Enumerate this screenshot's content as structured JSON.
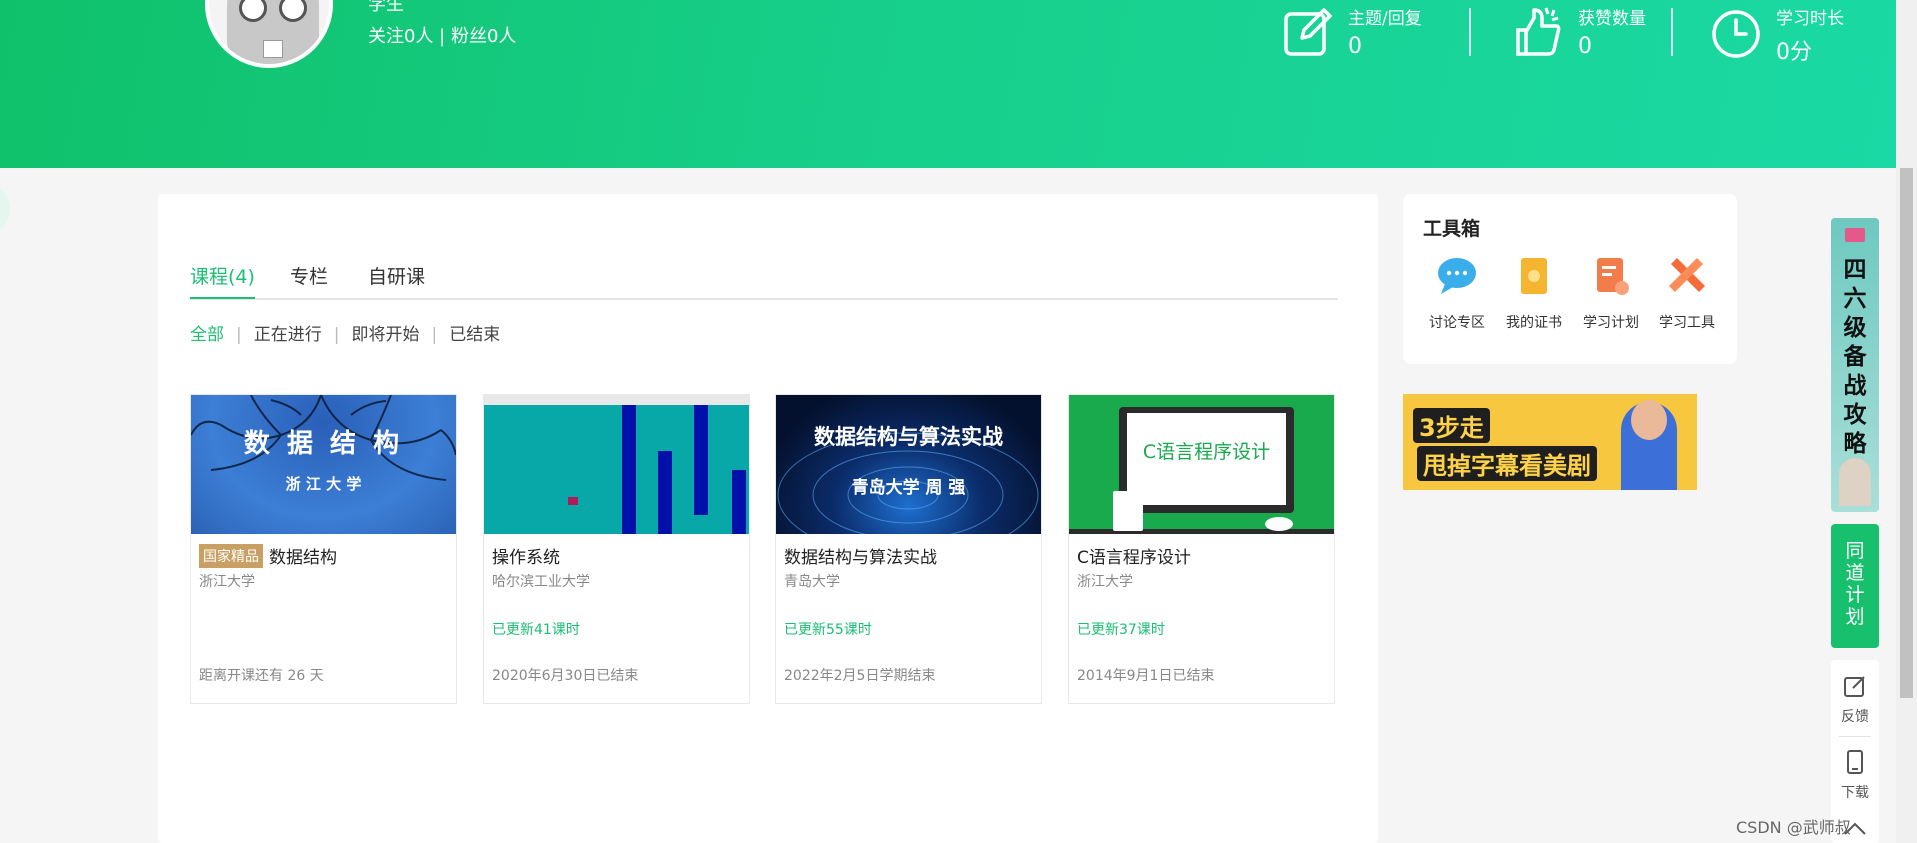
{
  "profile": {
    "name": "学生",
    "follow_text": "关注0人 | 粉丝0人"
  },
  "stats": [
    {
      "label": "主题/回复",
      "value": "0",
      "icon": "edit-icon"
    },
    {
      "label": "获赞数量",
      "value": "0",
      "icon": "thumbs-up-icon"
    },
    {
      "label": "学习时长",
      "value": "0分",
      "icon": "clock-icon"
    }
  ],
  "tabs": [
    {
      "label": "课程(4)",
      "active": true
    },
    {
      "label": "专栏",
      "active": false
    },
    {
      "label": "自研课",
      "active": false
    }
  ],
  "filters": [
    {
      "label": "全部",
      "active": true
    },
    {
      "label": "正在进行",
      "active": false
    },
    {
      "label": "即将开始",
      "active": false
    },
    {
      "label": "已结束",
      "active": false
    }
  ],
  "courses": [
    {
      "thumb_title": "数 据 结 构",
      "thumb_sub": "浙 江 大 学",
      "badge": "国家精品",
      "title": "数据结构",
      "school": "浙江大学",
      "update": "",
      "foot": "距离开课还有 26 天"
    },
    {
      "thumb_title": "",
      "thumb_sub": "",
      "badge": "",
      "title": "操作系统",
      "school": "哈尔滨工业大学",
      "update": "已更新41课时",
      "foot": "2020年6月30日已结束"
    },
    {
      "thumb_title": "数据结构与算法实战",
      "thumb_sub": "青岛大学   周 强",
      "badge": "",
      "title": "数据结构与算法实战",
      "school": "青岛大学",
      "update": "已更新55课时",
      "foot": "2022年2月5日学期结束"
    },
    {
      "thumb_title": "C语言程序设计",
      "thumb_sub": "",
      "badge": "",
      "title": "C语言程序设计",
      "school": "浙江大学",
      "update": "已更新37课时",
      "foot": "2014年9月1日已结束"
    }
  ],
  "toolbox": {
    "title": "工具箱",
    "items": [
      {
        "label": "讨论专区",
        "icon": "chat-bubble-icon",
        "color": "#3aaeea"
      },
      {
        "label": "我的证书",
        "icon": "certificate-icon",
        "color": "#f5b531"
      },
      {
        "label": "学习计划",
        "icon": "study-plan-icon",
        "color": "#f37d4a"
      },
      {
        "label": "学习工具",
        "icon": "tools-icon",
        "color": "#f56b3a"
      }
    ]
  },
  "banner": {
    "line1": "3步走",
    "line2": "甩掉字幕看美剧"
  },
  "rail": {
    "cet": "四六级备战攻略",
    "plan": "同道计划",
    "feedback": "反馈",
    "download": "下载"
  },
  "watermark": "CSDN @武师叔",
  "colors": {
    "brand_green": "#1bbf73",
    "header_gradient_start": "#0fc16a",
    "header_gradient_end": "#1ad9a4",
    "badge_gold": "#c9a063"
  }
}
